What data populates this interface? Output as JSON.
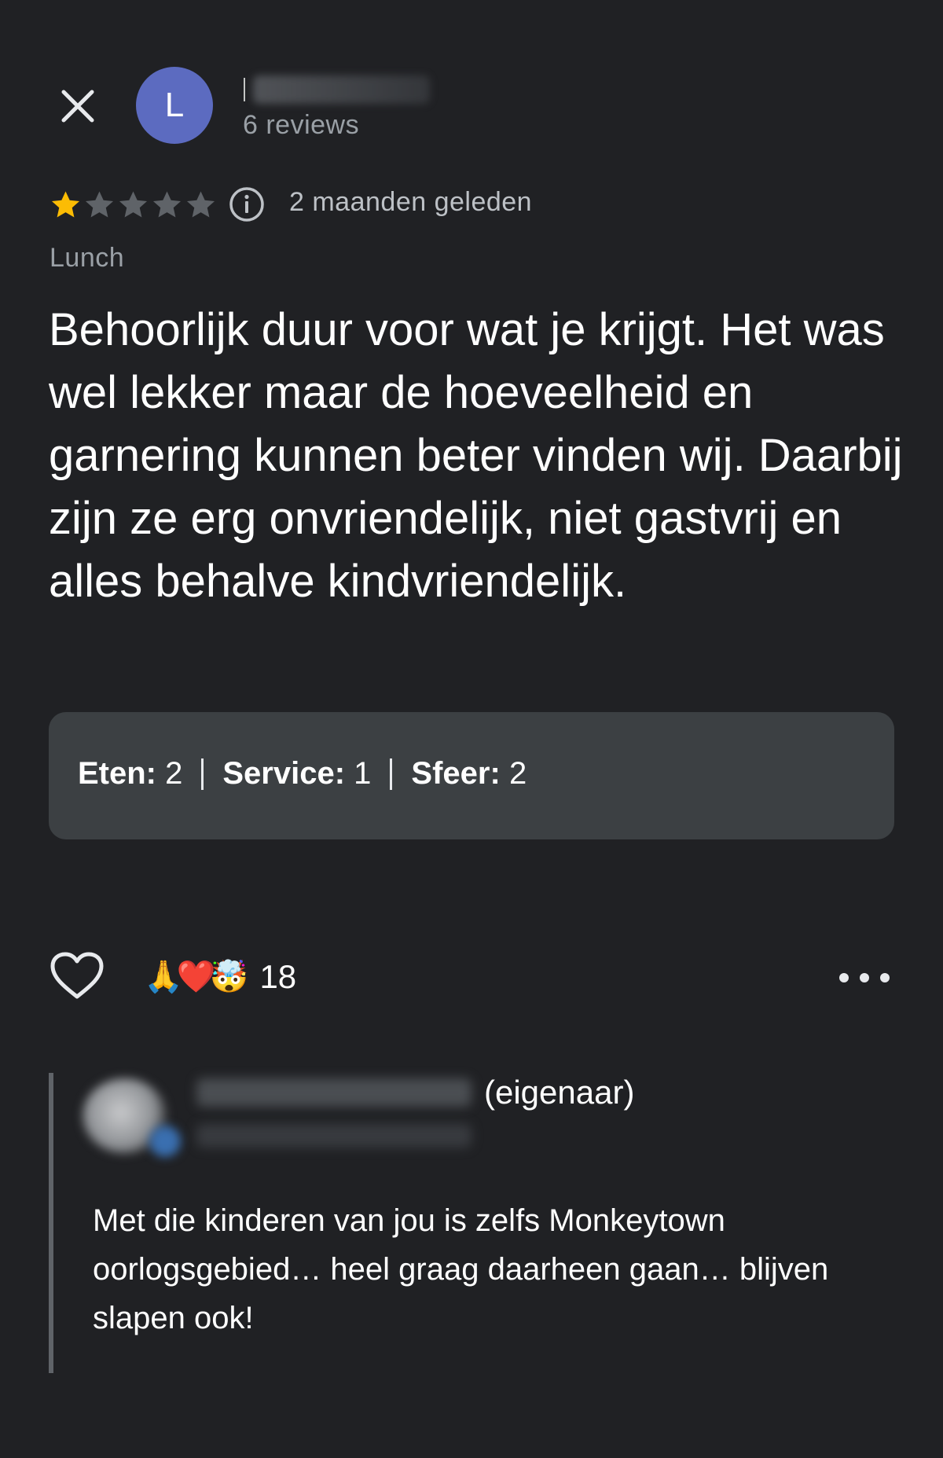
{
  "reviewer": {
    "initial": "L",
    "reviews_count": "6 reviews"
  },
  "rating": {
    "stars": 1,
    "max_stars": 5,
    "time_ago": "2 maanden geleden",
    "meal_type": "Lunch"
  },
  "review_text": "Behoorlijk duur voor wat je krijgt. Het was wel lekker maar de hoeveelheid en garnering kunnen beter vinden wij. Daarbij zijn ze erg onvriendelijk, niet gastvrij en alles behalve kindvriendelijk.",
  "subratings": [
    {
      "label": "Eten:",
      "value": "2"
    },
    {
      "label": "Service:",
      "value": "1"
    },
    {
      "label": "Sfeer:",
      "value": "2"
    }
  ],
  "reactions": {
    "emojis": [
      "🙏",
      "❤️",
      "🤯"
    ],
    "count": "18"
  },
  "owner_reply": {
    "owner_tag": "(eigenaar)",
    "text": "Met die kinderen van jou is zelfs Monkeytown oorlogsgebied… heel graag daarheen gaan… blijven slapen ook!"
  },
  "colors": {
    "background": "#202124",
    "avatar": "#5c6bc0",
    "star_filled": "#fbbc04",
    "star_empty": "#5f6368",
    "card": "#3c4043"
  }
}
